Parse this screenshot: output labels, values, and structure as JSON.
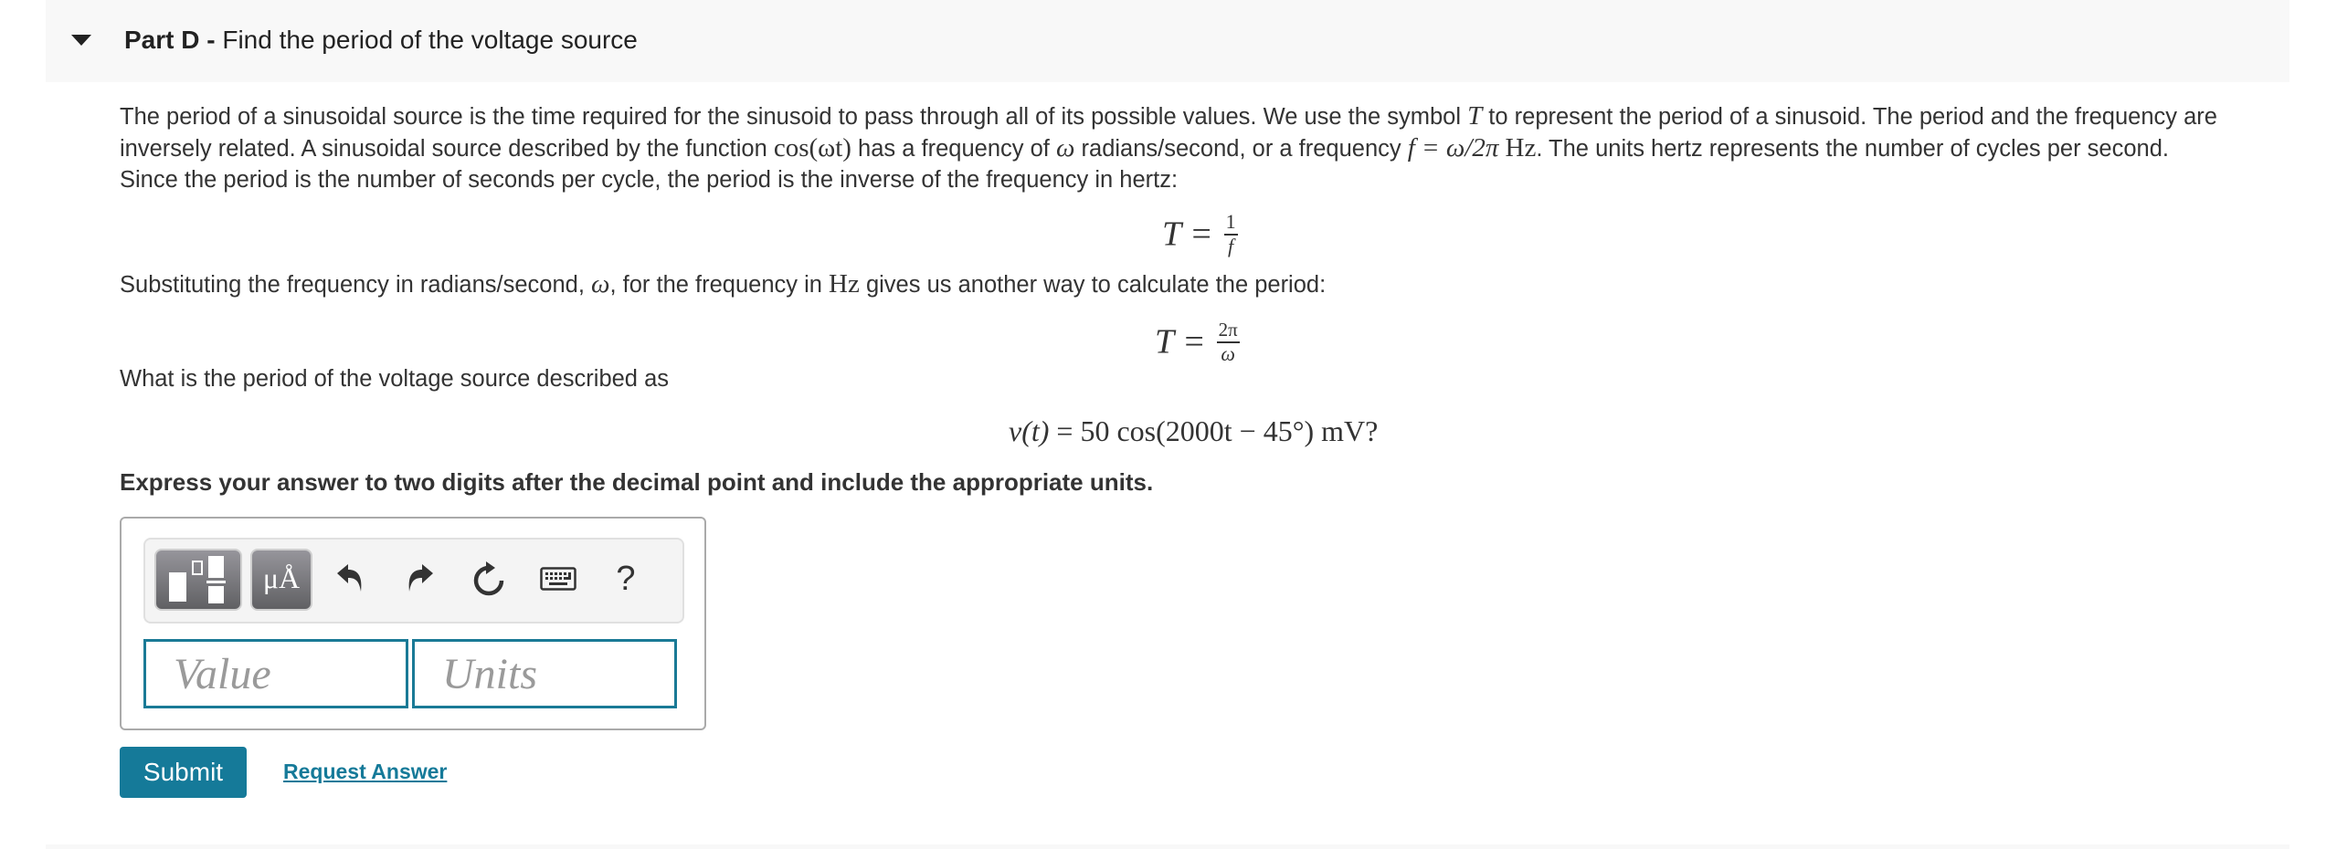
{
  "part": {
    "label": "Part D -",
    "title": "Find the period of the voltage source"
  },
  "intro": {
    "line1_a": "The period of a sinusoidal source is the time required for the sinusoid to pass through all of its possible values. We use the symbol ",
    "line1_sym": "T",
    "line1_b": " to represent the period of a sinusoid. The period and the frequency are",
    "line2_a": "inversely related. A sinusoidal source described by the function ",
    "line2_fn": "cos(ωt)",
    "line2_b": " has a frequency of ",
    "line2_omega": "ω",
    "line2_c": " radians/second, or a frequency ",
    "line2_eq": "f = ω/2π",
    "line2_hz": "Hz",
    "line2_d": ". The units hertz represents the number of cycles per second.",
    "line3": "Since the period is the number of seconds per cycle, the period is the inverse of the frequency in hertz:"
  },
  "eq1": {
    "lhs": "T =",
    "num": "1",
    "den": "f"
  },
  "substitute": {
    "a": "Substituting the frequency in radians/second, ",
    "omega": "ω",
    "b": ", for the frequency in ",
    "hz": "Hz",
    "c": " gives us another way to calculate the period:"
  },
  "eq2": {
    "lhs": "T =",
    "num": "2π",
    "den": "ω"
  },
  "question": "What is the period of the voltage source described as",
  "eq3": {
    "lhs": "v(t)",
    "rhs": "= 50 cos(2000t − 45°) mV?"
  },
  "instruction": "Express your answer to two digits after the decimal point and include the appropriate units.",
  "toolbar": {
    "units_label": "μÅ",
    "help_label": "?"
  },
  "inputs": {
    "value_placeholder": "Value",
    "value": "",
    "units_placeholder": "Units",
    "units": ""
  },
  "actions": {
    "submit_label": "Submit",
    "request_label": "Request Answer"
  },
  "colors": {
    "accent": "#157a99",
    "header_bg": "#f8f8f8",
    "text": "#333333"
  }
}
